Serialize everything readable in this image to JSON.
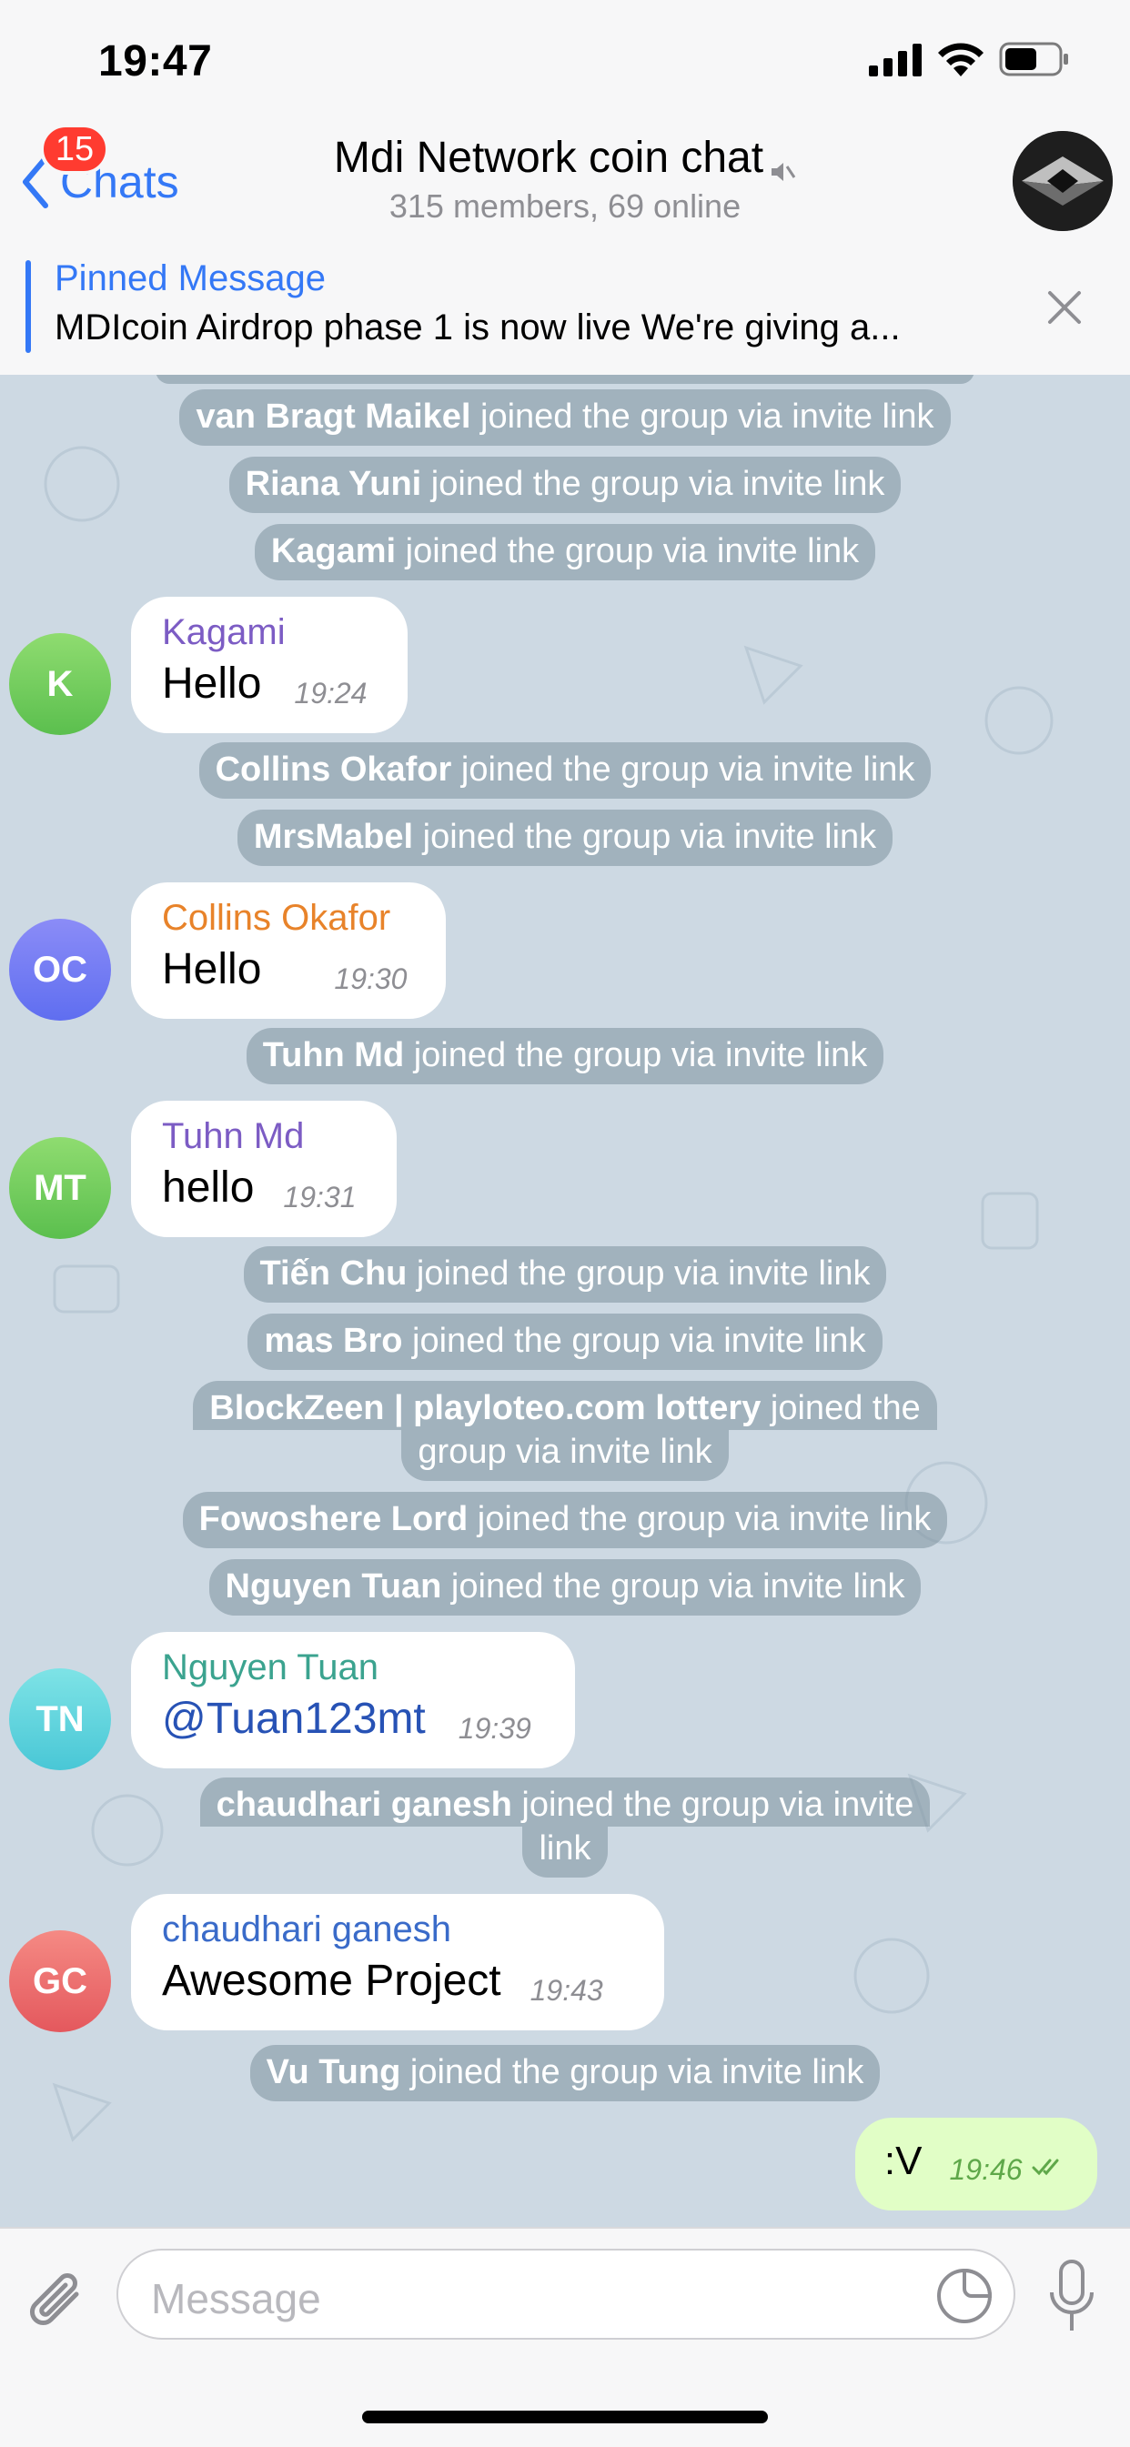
{
  "status": {
    "time": "19:47"
  },
  "nav": {
    "back_label": "Chats",
    "unread_badge": "15",
    "title": "Mdi Network coin chat",
    "subtitle": "315 members, 69 online"
  },
  "pinned": {
    "title": "Pinned Message",
    "text": "MDIcoin Airdrop phase 1 is now live We're giving a..."
  },
  "services": [
    {
      "name": "van Bragt Maikel",
      "text": " joined the group via invite link"
    },
    {
      "name": "Riana Yuni",
      "text": " joined the group via invite link"
    },
    {
      "name": "Kagami",
      "text": " joined the group via invite link"
    },
    {
      "name": "Collins Okafor",
      "text": " joined the group via invite link"
    },
    {
      "name": "MrsMabel",
      "text": " joined the group via invite link"
    },
    {
      "name": "Tuhn Md",
      "text": " joined the group via invite link"
    },
    {
      "name": "Tiến Chu",
      "text": " joined the group via invite link"
    },
    {
      "name": "mas Bro",
      "text": " joined the group via invite link"
    },
    {
      "name": "BlockZeen | playloteo.com lottery",
      "text": " joined the",
      "text2": "group via invite link"
    },
    {
      "name": "Fowoshere Lord",
      "text": " joined the group via invite link"
    },
    {
      "name": "Nguyen Tuan",
      "text": " joined the group via invite link"
    },
    {
      "name": "chaudhari ganesh",
      "text": " joined the group via invite",
      "text2": "link"
    },
    {
      "name": "Vu Tung",
      "text": " joined the group via invite link"
    }
  ],
  "messages": [
    {
      "initials": "K",
      "sender": "Kagami",
      "text": "Hello",
      "time": "19:24",
      "name_color": "#7c5cc4"
    },
    {
      "initials": "OC",
      "sender": "Collins Okafor",
      "text": "Hello",
      "time": "19:30",
      "name_color": "#e8832a"
    },
    {
      "initials": "MT",
      "sender": "Tuhn Md",
      "text": "hello",
      "time": "19:31",
      "name_color": "#7c5cc4"
    },
    {
      "initials": "TN",
      "sender": "Nguyen Tuan",
      "text": "@Tuan123mt",
      "time": "19:39",
      "name_color": "#3ba38f"
    },
    {
      "initials": "GC",
      "sender": "chaudhari ganesh",
      "text": "Awesome Project",
      "time": "19:43",
      "name_color": "#3a6bc9"
    }
  ],
  "outgoing": {
    "text": ":V",
    "time": "19:46"
  },
  "input": {
    "placeholder": "Message"
  },
  "icons": {
    "back": "chevron-left-icon",
    "mute": "speaker-muted-icon",
    "close": "close-icon",
    "attach": "paperclip-icon",
    "sticker": "sticker-icon",
    "mic": "microphone-icon",
    "read": "double-check-icon"
  },
  "colors": {
    "accent": "#3478f6",
    "badge": "#ff3b30",
    "outgoing_bubble": "#e1fec6",
    "chat_bg": "#cdd9e3"
  }
}
